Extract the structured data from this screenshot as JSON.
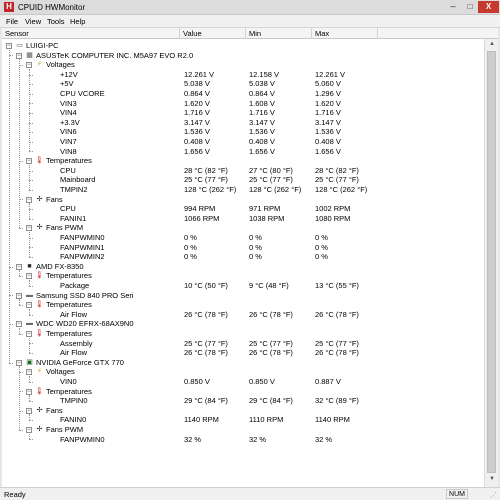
{
  "window": {
    "title": "CPUID HWMonitor",
    "app_icon_letter": "H",
    "minimize_glyph": "–",
    "maximize_glyph": "□",
    "close_glyph": "X"
  },
  "menu": [
    "File",
    "View",
    "Tools",
    "Help"
  ],
  "columns": {
    "sensor": "Sensor",
    "value": "Value",
    "min": "Min",
    "max": "Max"
  },
  "tree": [
    {
      "level": 0,
      "type": "computer",
      "label": "LUIGI-PC"
    },
    {
      "level": 1,
      "type": "board",
      "label": "ASUSTeK COMPUTER INC. M5A97 EVO R2.0"
    },
    {
      "level": 2,
      "type": "voltage",
      "label": "Voltages"
    },
    {
      "level": 3,
      "label": "+12V",
      "value": "12.261 V",
      "min": "12.158 V",
      "max": "12.261 V"
    },
    {
      "level": 3,
      "label": "+5V",
      "value": "5.038 V",
      "min": "5.038 V",
      "max": "5.060 V"
    },
    {
      "level": 3,
      "label": "CPU VCORE",
      "value": "0.864 V",
      "min": "0.864 V",
      "max": "1.296 V"
    },
    {
      "level": 3,
      "label": "VIN3",
      "value": "1.620 V",
      "min": "1.608 V",
      "max": "1.620 V"
    },
    {
      "level": 3,
      "label": "VIN4",
      "value": "1.716 V",
      "min": "1.716 V",
      "max": "1.716 V"
    },
    {
      "level": 3,
      "label": "+3.3V",
      "value": "3.147 V",
      "min": "3.147 V",
      "max": "3.147 V"
    },
    {
      "level": 3,
      "label": "VIN6",
      "value": "1.536 V",
      "min": "1.536 V",
      "max": "1.536 V"
    },
    {
      "level": 3,
      "label": "VIN7",
      "value": "0.408 V",
      "min": "0.408 V",
      "max": "0.408 V"
    },
    {
      "level": 3,
      "label": "VIN8",
      "value": "1.656 V",
      "min": "1.656 V",
      "max": "1.656 V"
    },
    {
      "level": 2,
      "type": "temperature",
      "label": "Temperatures"
    },
    {
      "level": 3,
      "label": "CPU",
      "value": "28 °C  (82 °F)",
      "min": "27 °C  (80 °F)",
      "max": "28 °C  (82 °F)"
    },
    {
      "level": 3,
      "label": "Mainboard",
      "value": "25 °C  (77 °F)",
      "min": "25 °C  (77 °F)",
      "max": "25 °C  (77 °F)"
    },
    {
      "level": 3,
      "label": "TMPIN2",
      "value": "128 °C  (262 °F)",
      "min": "128 °C  (262 °F)",
      "max": "128 °C  (262 °F)"
    },
    {
      "level": 2,
      "type": "fan",
      "label": "Fans"
    },
    {
      "level": 3,
      "label": "CPU",
      "value": "994 RPM",
      "min": "971 RPM",
      "max": "1002 RPM"
    },
    {
      "level": 3,
      "label": "FANIN1",
      "value": "1066 RPM",
      "min": "1038 RPM",
      "max": "1080 RPM"
    },
    {
      "level": 2,
      "type": "fan",
      "label": "Fans PWM"
    },
    {
      "level": 3,
      "label": "FANPWMIN0",
      "value": "0 %",
      "min": "0 %",
      "max": "0 %"
    },
    {
      "level": 3,
      "label": "FANPWMIN1",
      "value": "0 %",
      "min": "0 %",
      "max": "0 %"
    },
    {
      "level": 3,
      "label": "FANPWMIN2",
      "value": "0 %",
      "min": "0 %",
      "max": "0 %"
    },
    {
      "level": 1,
      "type": "cpu",
      "label": "AMD FX-8350"
    },
    {
      "level": 2,
      "type": "temperature",
      "label": "Temperatures"
    },
    {
      "level": 3,
      "label": "Package",
      "value": "10 °C  (50 °F)",
      "min": "9 °C  (48 °F)",
      "max": "13 °C  (55 °F)"
    },
    {
      "level": 1,
      "type": "disk",
      "label": "Samsung SSD 840 PRO Seri"
    },
    {
      "level": 2,
      "type": "temperature",
      "label": "Temperatures"
    },
    {
      "level": 3,
      "label": "Air Flow",
      "value": "26 °C  (78 °F)",
      "min": "26 °C  (78 °F)",
      "max": "26 °C  (78 °F)"
    },
    {
      "level": 1,
      "type": "disk",
      "label": "WDC WD20 EFRX-68AX9N0"
    },
    {
      "level": 2,
      "type": "temperature",
      "label": "Temperatures"
    },
    {
      "level": 3,
      "label": "Assembly",
      "value": "25 °C  (77 °F)",
      "min": "25 °C  (77 °F)",
      "max": "25 °C  (77 °F)"
    },
    {
      "level": 3,
      "label": "Air Flow",
      "value": "26 °C  (78 °F)",
      "min": "26 °C  (78 °F)",
      "max": "26 °C  (78 °F)"
    },
    {
      "level": 1,
      "type": "gpu",
      "label": "NVIDIA GeForce GTX 770"
    },
    {
      "level": 2,
      "type": "voltage",
      "label": "Voltages"
    },
    {
      "level": 3,
      "label": "VIN0",
      "value": "0.850 V",
      "min": "0.850 V",
      "max": "0.887 V"
    },
    {
      "level": 2,
      "type": "temperature",
      "label": "Temperatures"
    },
    {
      "level": 3,
      "label": "TMPIN0",
      "value": "29 °C  (84 °F)",
      "min": "29 °C  (84 °F)",
      "max": "32 °C  (89 °F)"
    },
    {
      "level": 2,
      "type": "fan",
      "label": "Fans"
    },
    {
      "level": 3,
      "label": "FANIN0",
      "value": "1140 RPM",
      "min": "1110 RPM",
      "max": "1140 RPM"
    },
    {
      "level": 2,
      "type": "fan",
      "label": "Fans PWM"
    },
    {
      "level": 3,
      "label": "FANPWMIN0",
      "value": "32 %",
      "min": "32 %",
      "max": "32 %"
    }
  ],
  "status": {
    "text": "Ready",
    "num": "NUM"
  },
  "colors": {
    "voltage": "#c9a400",
    "temperature": "#d02020",
    "fan": "#1c1c1c",
    "cpu": "#2a2a2a",
    "disk": "#6c6c6c",
    "gpu": "#1f6a1f",
    "close_button": "#c7382e",
    "app_icon": "#c0262b"
  },
  "icons": {
    "computer": "computer-icon",
    "board": "motherboard-icon",
    "voltage": "voltage-icon",
    "temperature": "thermometer-icon",
    "fan": "fan-icon",
    "cpu": "cpu-chip-icon",
    "disk": "disk-drive-icon",
    "gpu": "gpu-card-icon"
  }
}
